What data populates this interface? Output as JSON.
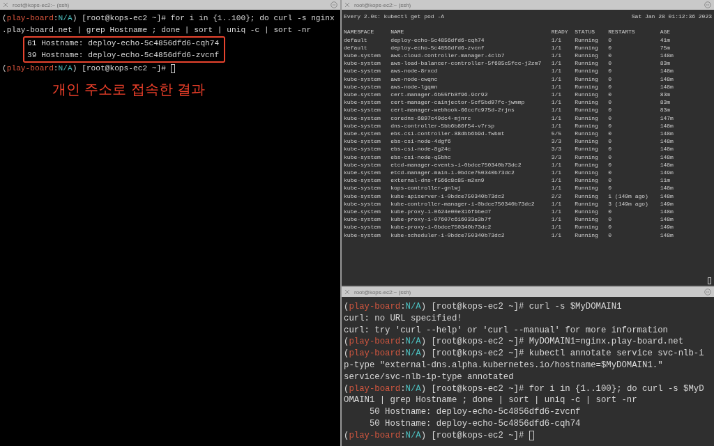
{
  "panes": [
    {
      "title": "root@kops-ec2:~ (ssh)",
      "kind": "shell",
      "lines": [
        {
          "kind": "prompt",
          "prefix": "(",
          "context": "play-board",
          "separator": ":",
          "namespace": "N/A",
          "command": ") [root@kops-ec2 ~]# for i in {1..100}; do curl -s nginx"
        },
        {
          "kind": "output",
          "text": ".play-board.net | grep Hostname ; done | sort | uniq -c | sort -nr"
        },
        {
          "kind": "output",
          "highlighted": true,
          "text": "61 Hostname: deploy-echo-5c4856dfd6-cqh74"
        },
        {
          "kind": "output",
          "highlighted": true,
          "text": "39 Hostname: deploy-echo-5c4856dfd6-zvcnf"
        },
        {
          "kind": "prompt",
          "cursor": true,
          "prefix": "(",
          "context": "play-board",
          "separator": ":",
          "namespace": "N/A",
          "command": ") [root@kops-ec2 ~]#"
        }
      ],
      "annotation": "개인 주소로 접속한 결과"
    },
    {
      "title": "root@kops-ec2:~ (ssh)",
      "kind": "watch",
      "watch_command": "Every 2.0s: kubectl get pod -A",
      "timestamp": "Sat Jan 28 01:12:36 2023",
      "columns": [
        "NAMESPACE",
        "NAME",
        "READY",
        "STATUS",
        "RESTARTS",
        "AGE"
      ],
      "rows": [
        [
          "default",
          "deploy-echo-5c4856dfd6-cqh74",
          "1/1",
          "Running",
          "0",
          "41m"
        ],
        [
          "default",
          "deploy-echo-5c4856dfd6-zvcnf",
          "1/1",
          "Running",
          "0",
          "75m"
        ],
        [
          "kube-system",
          "aws-cloud-controller-manager-4clb7",
          "1/1",
          "Running",
          "0",
          "148m"
        ],
        [
          "kube-system",
          "aws-load-balancer-controller-5f685c5fcc-j2zm7",
          "1/1",
          "Running",
          "0",
          "83m"
        ],
        [
          "kube-system",
          "aws-node-8rxcd",
          "1/1",
          "Running",
          "0",
          "148m"
        ],
        [
          "kube-system",
          "aws-node-cwqnc",
          "1/1",
          "Running",
          "0",
          "148m"
        ],
        [
          "kube-system",
          "aws-node-lgqmn",
          "1/1",
          "Running",
          "0",
          "148m"
        ],
        [
          "kube-system",
          "cert-manager-6b55fb8f96-9cr92",
          "1/1",
          "Running",
          "0",
          "83m"
        ],
        [
          "kube-system",
          "cert-manager-cainjector-5cf5bd97fc-jwmmp",
          "1/1",
          "Running",
          "0",
          "83m"
        ],
        [
          "kube-system",
          "cert-manager-webhook-66ccfc975d-2rjns",
          "1/1",
          "Running",
          "0",
          "83m"
        ],
        [
          "kube-system",
          "coredns-6897c49dc4-mjnrc",
          "1/1",
          "Running",
          "0",
          "147m"
        ],
        [
          "kube-system",
          "dns-controller-5bb6b86f54-v7rsp",
          "1/1",
          "Running",
          "0",
          "148m"
        ],
        [
          "kube-system",
          "ebs-csi-controller-88dbb6b9d-fwbmt",
          "5/5",
          "Running",
          "0",
          "148m"
        ],
        [
          "kube-system",
          "ebs-csi-node-4dgf6",
          "3/3",
          "Running",
          "0",
          "148m"
        ],
        [
          "kube-system",
          "ebs-csi-node-8g24c",
          "3/3",
          "Running",
          "0",
          "148m"
        ],
        [
          "kube-system",
          "ebs-csi-node-q5bhc",
          "3/3",
          "Running",
          "0",
          "148m"
        ],
        [
          "kube-system",
          "etcd-manager-events-i-0bdce750340b73dc2",
          "1/1",
          "Running",
          "0",
          "148m"
        ],
        [
          "kube-system",
          "etcd-manager-main-i-0bdce750340b73dc2",
          "1/1",
          "Running",
          "0",
          "149m"
        ],
        [
          "kube-system",
          "external-dns-f566c8c85-m2xn9",
          "1/1",
          "Running",
          "0",
          "11m"
        ],
        [
          "kube-system",
          "kops-controller-gnlwj",
          "1/1",
          "Running",
          "0",
          "148m"
        ],
        [
          "kube-system",
          "kube-apiserver-i-0bdce750340b73dc2",
          "2/2",
          "Running",
          "1 (149m ago)",
          "148m"
        ],
        [
          "kube-system",
          "kube-controller-manager-i-0bdce750340b73dc2",
          "1/1",
          "Running",
          "3 (149m ago)",
          "149m"
        ],
        [
          "kube-system",
          "kube-proxy-i-0624e00e316fbbed7",
          "1/1",
          "Running",
          "0",
          "148m"
        ],
        [
          "kube-system",
          "kube-proxy-i-07607c616033e3b7f",
          "1/1",
          "Running",
          "0",
          "148m"
        ],
        [
          "kube-system",
          "kube-proxy-i-0bdce750340b73dc2",
          "1/1",
          "Running",
          "0",
          "149m"
        ],
        [
          "kube-system",
          "kube-scheduler-i-0bdce750340b73dc2",
          "1/1",
          "Running",
          "0",
          "148m"
        ]
      ]
    },
    {
      "title": "root@kops-ec2:~ (ssh)",
      "kind": "shell",
      "lines": [
        {
          "kind": "prompt",
          "prefix": "(",
          "context": "play-board",
          "separator": ":",
          "namespace": "N/A",
          "command": ") [root@kops-ec2 ~]# curl -s $MyDOMAIN1"
        },
        {
          "kind": "output",
          "text": "curl: no URL specified!"
        },
        {
          "kind": "output",
          "text": "curl: try 'curl --help' or 'curl --manual' for more information"
        },
        {
          "kind": "prompt",
          "prefix": "(",
          "context": "play-board",
          "separator": ":",
          "namespace": "N/A",
          "command": ") [root@kops-ec2 ~]# MyDOMAIN1=nginx.play-board.net"
        },
        {
          "kind": "prompt",
          "prefix": "(",
          "context": "play-board",
          "separator": ":",
          "namespace": "N/A",
          "command": ") [root@kops-ec2 ~]# kubectl annotate service svc-nlb-i"
        },
        {
          "kind": "output",
          "text": "p-type \"external-dns.alpha.kubernetes.io/hostname=$MyDOMAIN1.\""
        },
        {
          "kind": "output",
          "text": "service/svc-nlb-ip-type annotated"
        },
        {
          "kind": "prompt",
          "prefix": "(",
          "context": "play-board",
          "separator": ":",
          "namespace": "N/A",
          "command": ") [root@kops-ec2 ~]# for i in {1..100}; do curl -s $MyD"
        },
        {
          "kind": "output",
          "text": "OMAIN1 | grep Hostname ; done | sort | uniq -c | sort -nr"
        },
        {
          "kind": "output",
          "text": "     50 Hostname: deploy-echo-5c4856dfd6-zvcnf"
        },
        {
          "kind": "output",
          "text": "     50 Hostname: deploy-echo-5c4856dfd6-cqh74"
        },
        {
          "kind": "prompt",
          "cursor": true,
          "prefix": "(",
          "context": "play-board",
          "separator": ":",
          "namespace": "N/A",
          "command": ") [root@kops-ec2 ~]#"
        }
      ]
    }
  ]
}
